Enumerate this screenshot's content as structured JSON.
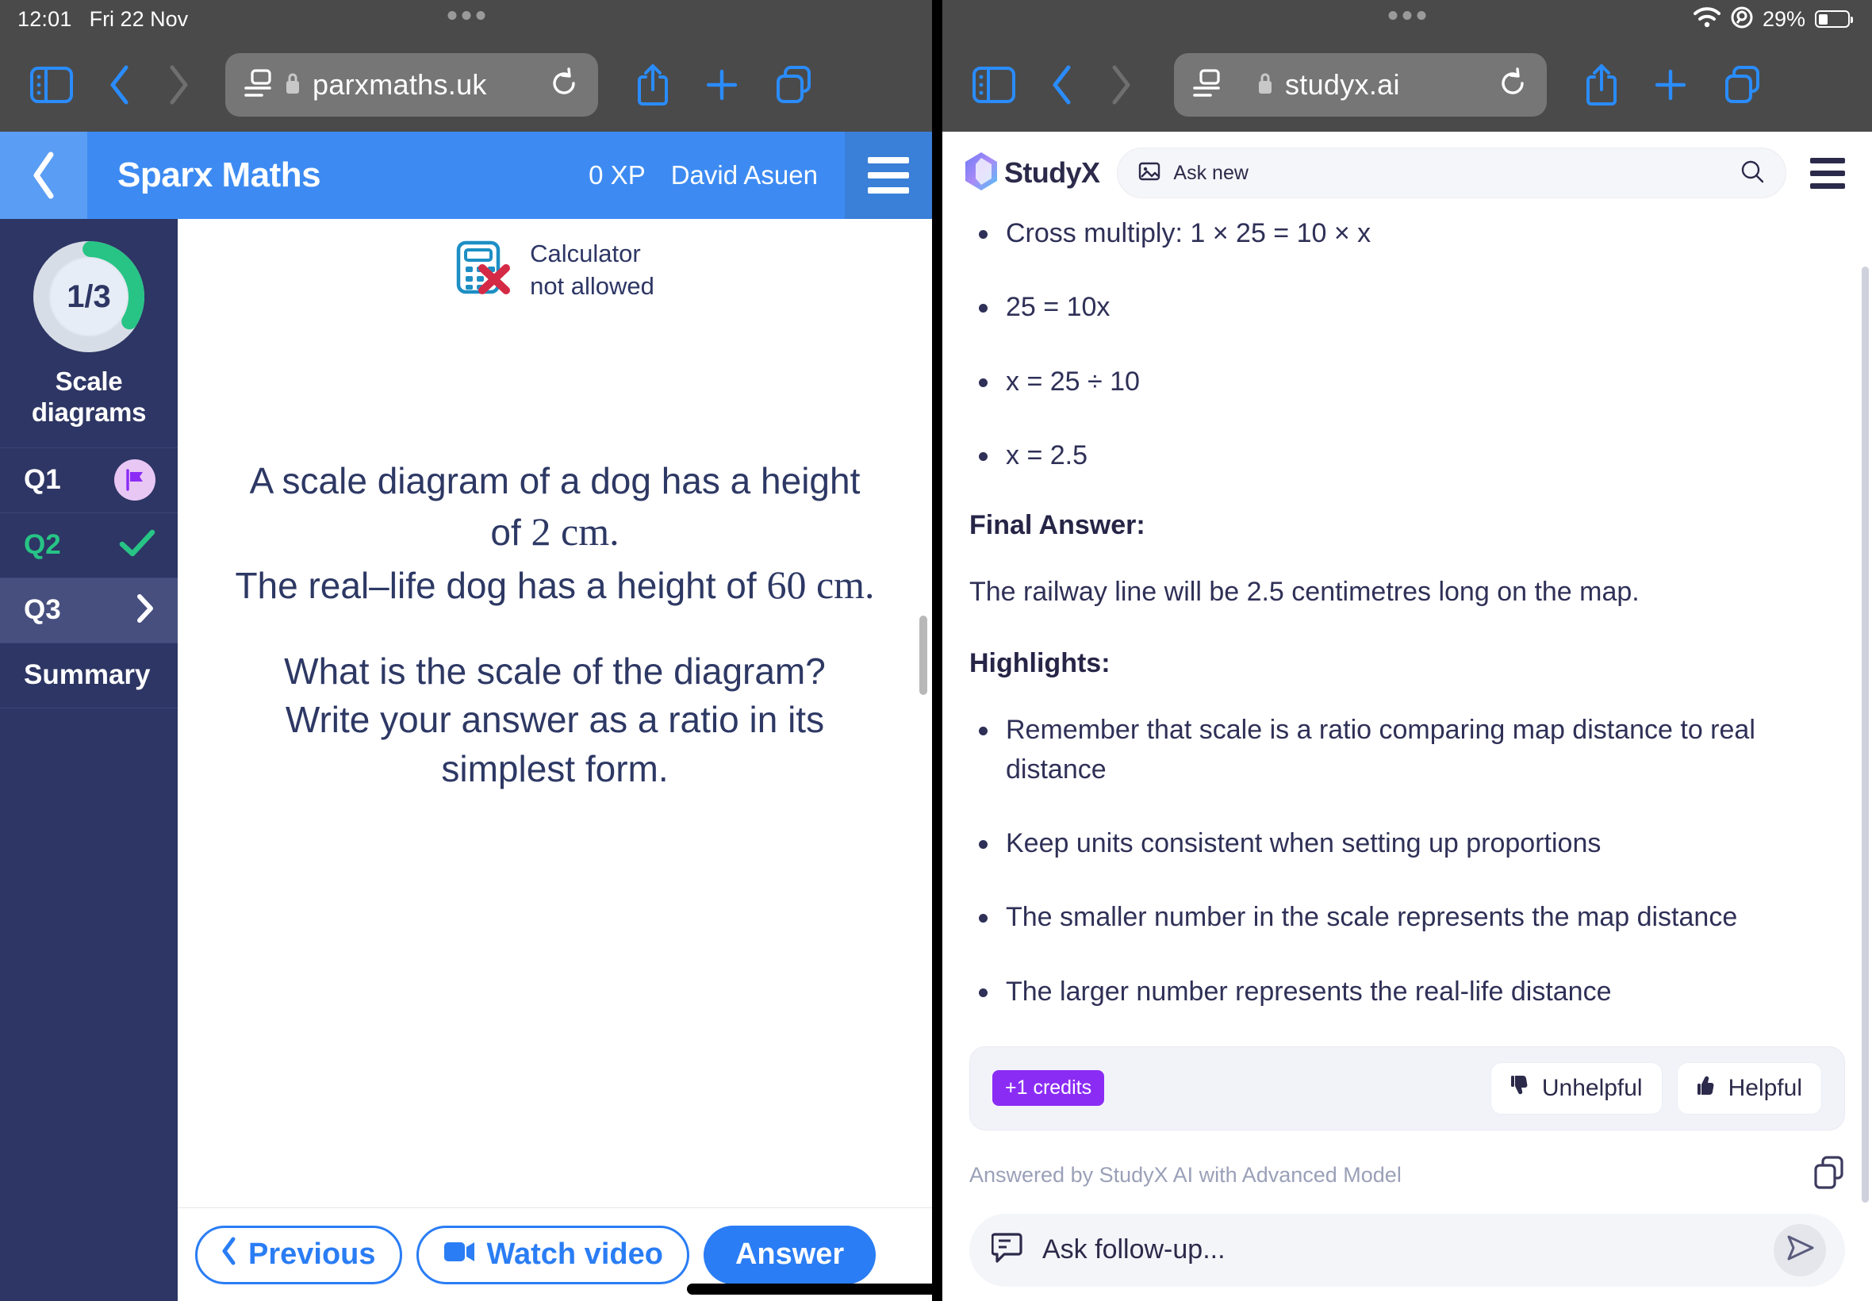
{
  "status_bar": {
    "time": "12:01",
    "date": "Fri 22 Nov",
    "battery_percent": "29%",
    "wifi_icon": "wifi-icon",
    "location_icon": "location-icon",
    "battery_icon": "battery-icon"
  },
  "browser_left": {
    "sidebar_icon": "sidebar-toggle-icon",
    "back_icon": "chevron-left-icon",
    "forward_icon": "chevron-right-icon",
    "reader_icon": "page-settings-icon",
    "lock_icon": "lock-icon",
    "url": "parxmaths.uk",
    "reload_icon": "reload-icon",
    "share_icon": "share-icon",
    "new_tab_icon": "plus-icon",
    "tabs_icon": "tabs-icon"
  },
  "browser_right": {
    "sidebar_icon": "sidebar-toggle-icon",
    "back_icon": "chevron-left-icon",
    "forward_icon": "chevron-right-icon",
    "reader_icon": "page-settings-icon",
    "lock_icon": "lock-icon",
    "url": "studyx.ai",
    "reload_icon": "reload-icon",
    "share_icon": "share-icon",
    "new_tab_icon": "plus-icon",
    "tabs_icon": "tabs-icon"
  },
  "sparx": {
    "header": {
      "back_icon": "chevron-left-icon",
      "title": "Sparx Maths",
      "xp": "0 XP",
      "user": "David Asuen",
      "menu_icon": "hamburger-menu-icon"
    },
    "sidebar": {
      "progress_label": "1/3",
      "progress_done": 1,
      "progress_total": 3,
      "topic_line1": "Scale",
      "topic_line2": "diagrams",
      "questions": [
        {
          "label": "Q1",
          "state": "flagged",
          "icon": "flag-icon"
        },
        {
          "label": "Q2",
          "state": "correct",
          "icon": "check-icon"
        },
        {
          "label": "Q3",
          "state": "current",
          "icon": "chevron-right-icon"
        }
      ],
      "summary_label": "Summary"
    },
    "calculator_notice": {
      "icon": "calculator-not-allowed-icon",
      "line1": "Calculator",
      "line2": "not allowed"
    },
    "question": {
      "line1_a": "A scale diagram of a dog has a height",
      "line1_b": "of ",
      "line1_num": "2",
      "line1_c": " cm.",
      "line2_a": "The real–life dog has a height of ",
      "line2_num": "60",
      "line2_b": " cm.",
      "line3": "What is the scale of the diagram?",
      "line4": "Write your answer as a ratio in its",
      "line5": "simplest form."
    },
    "footer": {
      "previous_label": "Previous",
      "previous_icon": "chevron-left-icon",
      "watch_video_label": "Watch video",
      "watch_video_icon": "video-camera-icon",
      "answer_label": "Answer"
    }
  },
  "studyx": {
    "header": {
      "logo_text": "StudyX",
      "logo_icon": "studyx-logo-icon",
      "search_placeholder": "Ask new",
      "search_image_icon": "image-icon",
      "search_icon": "search-icon",
      "menu_icon": "hamburger-menu-icon"
    },
    "steps": [
      "Cross multiply: 1 × 25 = 10 × x",
      "25 = 10x",
      "x = 25 ÷ 10",
      "x = 2.5"
    ],
    "final_answer_heading": "Final Answer:",
    "final_answer_text": "The railway line will be 2.5 centimetres long on the map.",
    "highlights_heading": "Highlights:",
    "highlights": [
      "Remember that scale is a ratio comparing map distance to real distance",
      "Keep units consistent when setting up proportions",
      "The smaller number in the scale represents the map distance",
      "The larger number represents the real-life distance"
    ],
    "feedback_card": {
      "credits_label": "+1 credits",
      "unhelpful_label": "Unhelpful",
      "unhelpful_icon": "thumbs-down-icon",
      "helpful_label": "Helpful",
      "helpful_icon": "thumbs-up-icon"
    },
    "answered_by": "Answered by StudyX AI with Advanced Model",
    "copy_icon": "copy-icon",
    "followup": {
      "icon": "chat-bubble-icon",
      "placeholder": "Ask follow-up...",
      "send_icon": "send-icon"
    }
  },
  "colors": {
    "sparx_blue": "#3d8bf2",
    "sparx_navy": "#2d3664",
    "green": "#27c486",
    "purple": "#8b2cf5",
    "link_blue": "#2a7df4"
  }
}
